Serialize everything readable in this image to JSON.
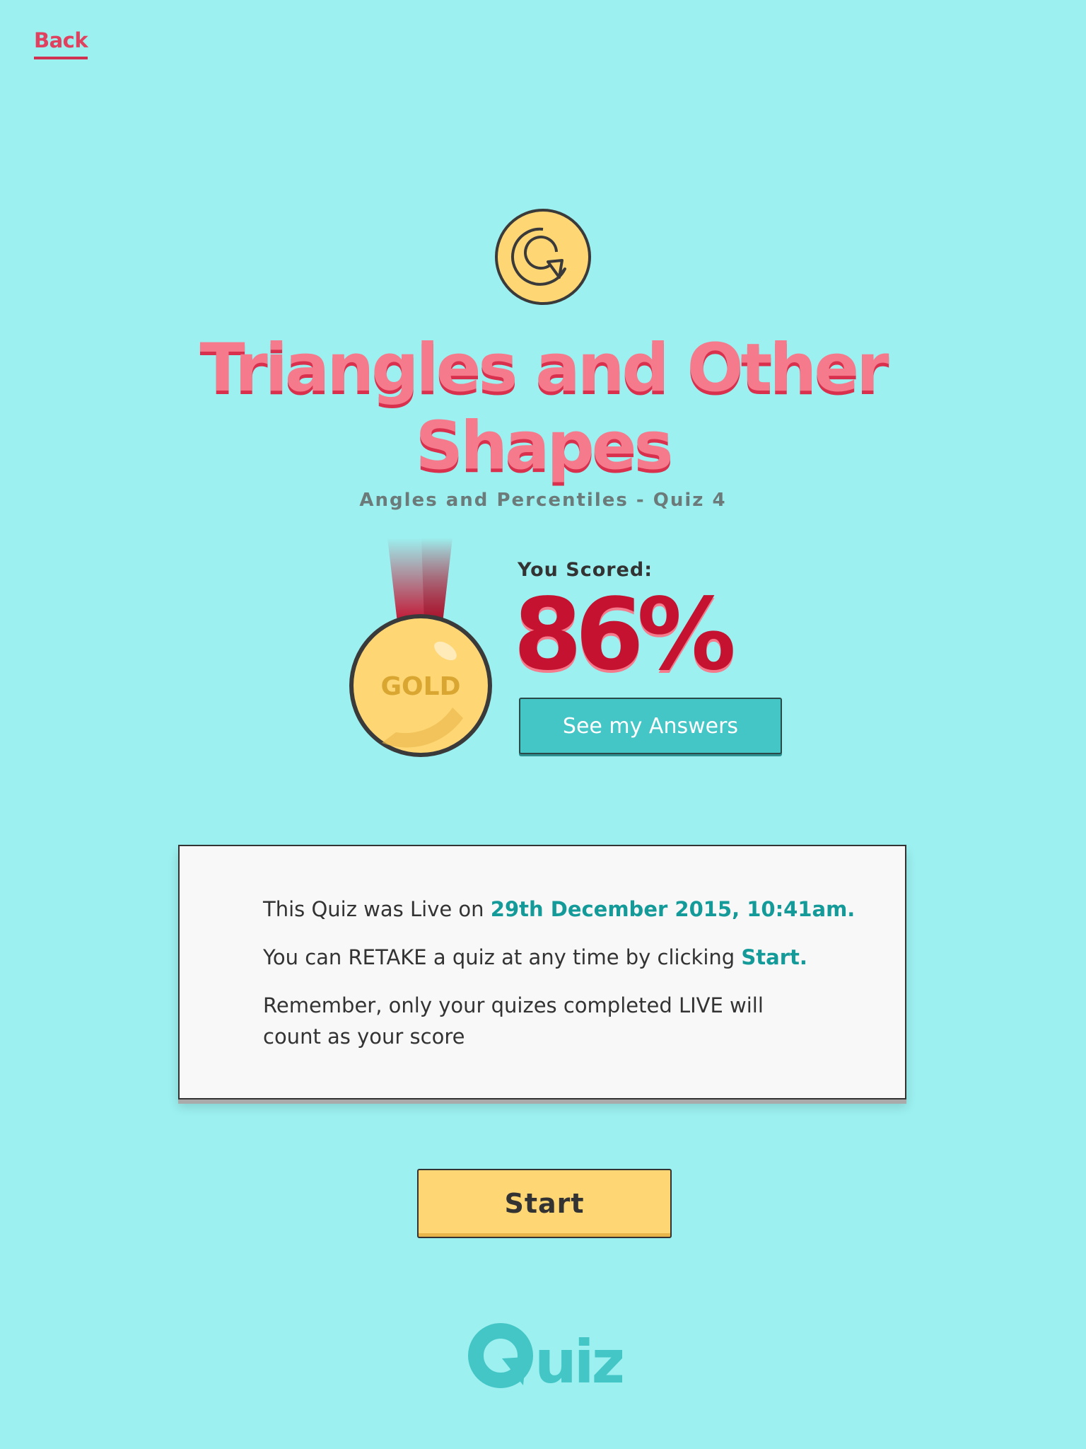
{
  "nav": {
    "back_label": "Back"
  },
  "quiz": {
    "title": "Triangles and Other Shapes",
    "subtitle": "Angles and Percentiles - Quiz 4"
  },
  "result": {
    "medal_label": "GOLD",
    "scored_label": "You Scored:",
    "score": "86%",
    "answers_button": "See my Answers"
  },
  "info": {
    "line1_prefix": "This Quiz was Live on ",
    "line1_date": "29th December 2015, 10:41am.",
    "line2_prefix": "You can RETAKE a quiz at any time by clicking ",
    "line2_link": "Start.",
    "line3": "Remember, only your quizes completed LIVE will count as your score"
  },
  "actions": {
    "start_label": "Start"
  },
  "footer": {
    "logo_text": "uiz"
  },
  "colors": {
    "background": "#9cf0f0",
    "title": "#f47a8c",
    "score": "#c41230",
    "accent_teal": "#45c6c6",
    "highlight": "#159a9a",
    "start_button": "#fed674"
  }
}
